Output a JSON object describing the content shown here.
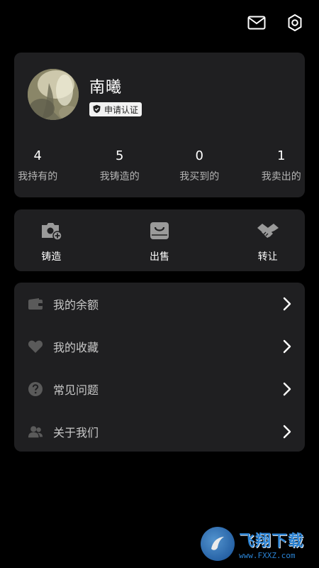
{
  "profile": {
    "name": "南曦",
    "verify_label": "申请认证",
    "avatar_icon": "avatar-image"
  },
  "stats": [
    {
      "value": "4",
      "label": "我持有的"
    },
    {
      "value": "5",
      "label": "我铸造的"
    },
    {
      "value": "0",
      "label": "我买到的"
    },
    {
      "value": "1",
      "label": "我卖出的"
    }
  ],
  "actions": [
    {
      "label": "铸造",
      "icon": "camera-plus-icon"
    },
    {
      "label": "出售",
      "icon": "bag-icon"
    },
    {
      "label": "转让",
      "icon": "handshake-icon"
    }
  ],
  "menu": [
    {
      "label": "我的余额",
      "icon": "wallet-icon"
    },
    {
      "label": "我的收藏",
      "icon": "heart-icon"
    },
    {
      "label": "常见问题",
      "icon": "question-icon"
    },
    {
      "label": "关于我们",
      "icon": "users-icon"
    }
  ],
  "topbar": {
    "mail_icon": "mail-icon",
    "settings_icon": "gear-icon"
  },
  "watermark": {
    "title": "飞翔下载",
    "url": "www.FXXZ.com"
  },
  "colors": {
    "background": "#000000",
    "card": "#1f1f21",
    "muted_text": "#b4b4b4",
    "watermark_blue": "#2f8fe6"
  }
}
